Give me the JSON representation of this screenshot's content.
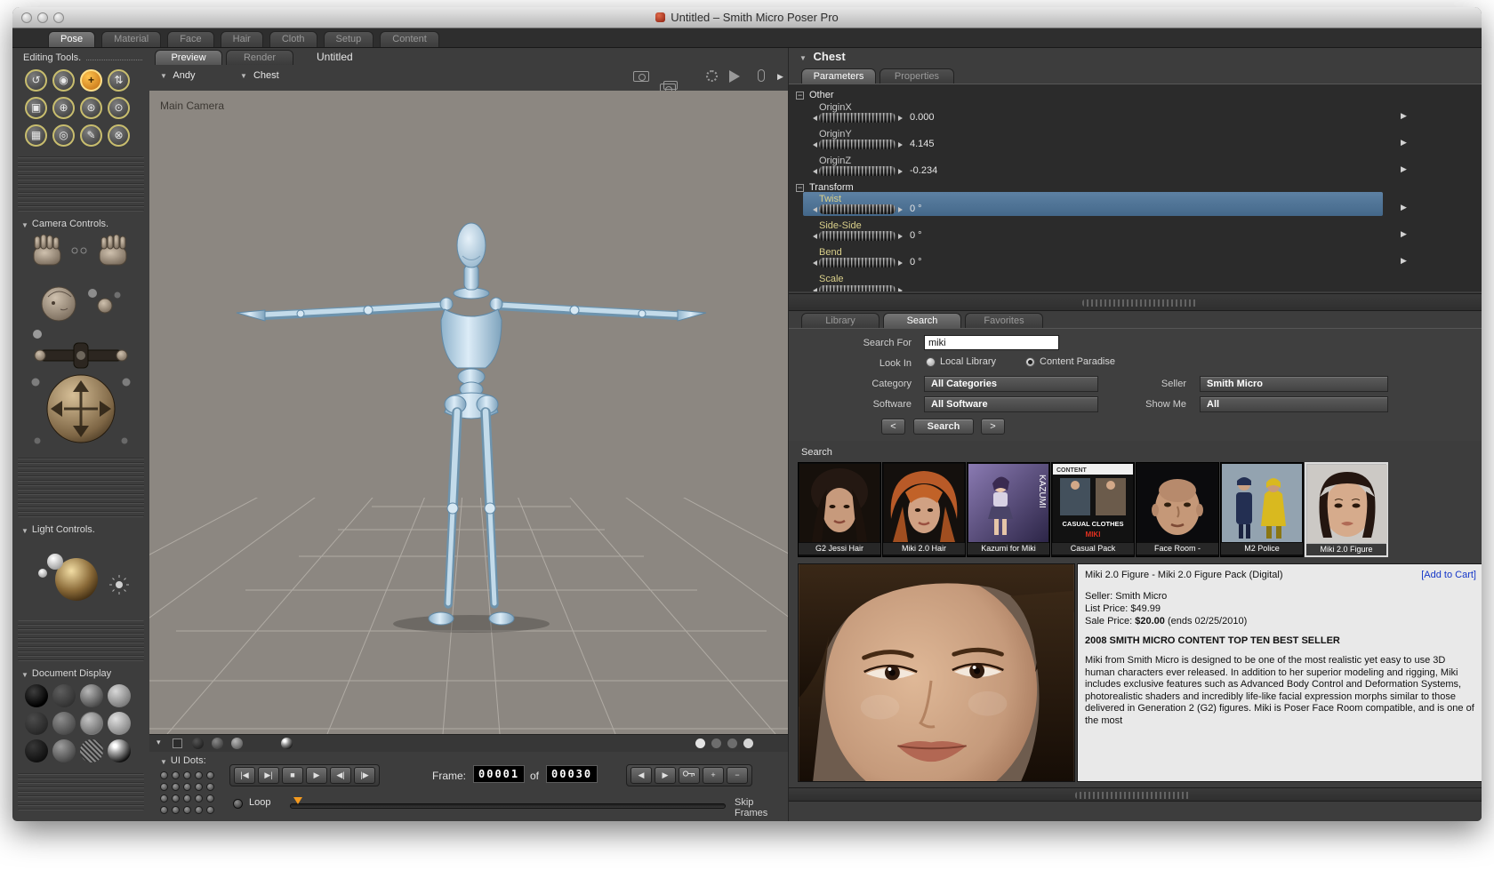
{
  "window_title": "Untitled – Smith Micro Poser Pro",
  "room_tabs": [
    "Pose",
    "Material",
    "Face",
    "Hair",
    "Cloth",
    "Setup",
    "Content"
  ],
  "icons": {
    "disclosure": "▼",
    "collapse": "−",
    "row_arrow": "▶",
    "strip_tri": "▾"
  },
  "sidebar": {
    "editing_tools_label": "Editing Tools.",
    "camera_controls_label": "Camera Controls.",
    "light_controls_label": "Light Controls.",
    "document_display_label": "Document Display",
    "tools": [
      {
        "glyph": "↺"
      },
      {
        "glyph": "◉"
      },
      {
        "glyph": "+",
        "selected": true
      },
      {
        "glyph": "⇅"
      },
      {
        "glyph": "▣"
      },
      {
        "glyph": "⊕"
      },
      {
        "glyph": "⊛"
      },
      {
        "glyph": "⊙"
      },
      {
        "glyph": "▦"
      },
      {
        "glyph": "◎"
      },
      {
        "glyph": "✎"
      },
      {
        "glyph": "⊗"
      }
    ]
  },
  "viewport": {
    "doc_tabs": [
      "Preview",
      "Render"
    ],
    "doc_title": "Untitled",
    "figure_selector": "Andy",
    "actor_selector": "Chest",
    "camera_label": "Main Camera"
  },
  "timeline": {
    "ui_dots_label": "UI Dots:",
    "transport": [
      "|◀",
      "▶|",
      "■",
      "▶",
      "◀|",
      "|▶"
    ],
    "frame_label": "Frame:",
    "frame_current": "00001",
    "of_label": "of",
    "frame_total": "00030",
    "edit_prev": "◀",
    "edit_next": "▶",
    "edit_add": "+",
    "edit_remove": "−",
    "loop_label": "Loop",
    "skip_frames_label": "Skip Frames"
  },
  "parameters": {
    "header": "Chest",
    "tabs": [
      "Parameters",
      "Properties"
    ],
    "group_other": "Other",
    "group_transform": "Transform",
    "rows": [
      {
        "label": "OriginX",
        "value": "0.000"
      },
      {
        "label": "OriginY",
        "value": "4.145"
      },
      {
        "label": "OriginZ",
        "value": "-0.234"
      },
      {
        "label": "Twist",
        "value": "0 °"
      },
      {
        "label": "Side-Side",
        "value": "0 °"
      },
      {
        "label": "Bend",
        "value": "0 °"
      },
      {
        "label": "Scale",
        "value": ""
      }
    ]
  },
  "library": {
    "tabs": [
      "Library",
      "Search",
      "Favorites"
    ],
    "search_for_label": "Search For",
    "search_value": "miki",
    "look_in_label": "Look In",
    "local_library_label": "Local Library",
    "content_paradise_label": "Content Paradise",
    "category_label": "Category",
    "category_value": "All Categories",
    "seller_label": "Seller",
    "seller_value": "Smith Micro",
    "software_label": "Software",
    "software_value": "All Software",
    "show_me_label": "Show Me",
    "show_me_value": "All",
    "prev_label": "<",
    "search_button_label": "Search",
    "next_label": ">",
    "results_header": "Search",
    "thumbnails": [
      {
        "caption": "G2 Jessi Hair"
      },
      {
        "caption": "Miki 2.0 Hair"
      },
      {
        "caption": "Kazumi for Miki",
        "overlay": "KAZUMI"
      },
      {
        "caption": "Casual Pack",
        "overlay_top": "CONTENT",
        "overlay_mid": "CASUAL CLOTHES",
        "overlay_red": "MIKI"
      },
      {
        "caption": "Face Room -"
      },
      {
        "caption": "M2 Police"
      },
      {
        "caption": "Miki 2.0 Figure"
      }
    ]
  },
  "product": {
    "title": "Miki 2.0 Figure - Miki 2.0 Figure Pack (Digital)",
    "add_to_cart": "[Add to Cart]",
    "seller_line": "Seller: Smith Micro",
    "list_price_line": "List Price: $49.99",
    "sale_price_prefix": "Sale Price: ",
    "sale_price_value": "$20.00",
    "sale_price_suffix": " (ends 02/25/2010)",
    "banner": "2008 SMITH MICRO CONTENT TOP TEN BEST SELLER",
    "description": "Miki from Smith Micro is designed to be one of the most realistic yet easy to use 3D human characters ever released. In addition to her superior modeling and rigging, Miki includes exclusive features such as Advanced Body Control and Deformation Systems, photorealistic shaders and incredibly life-like facial expression morphs similar to those delivered in Generation 2 (G2) figures. Miki is Poser Face Room compatible, and is one of the most"
  }
}
